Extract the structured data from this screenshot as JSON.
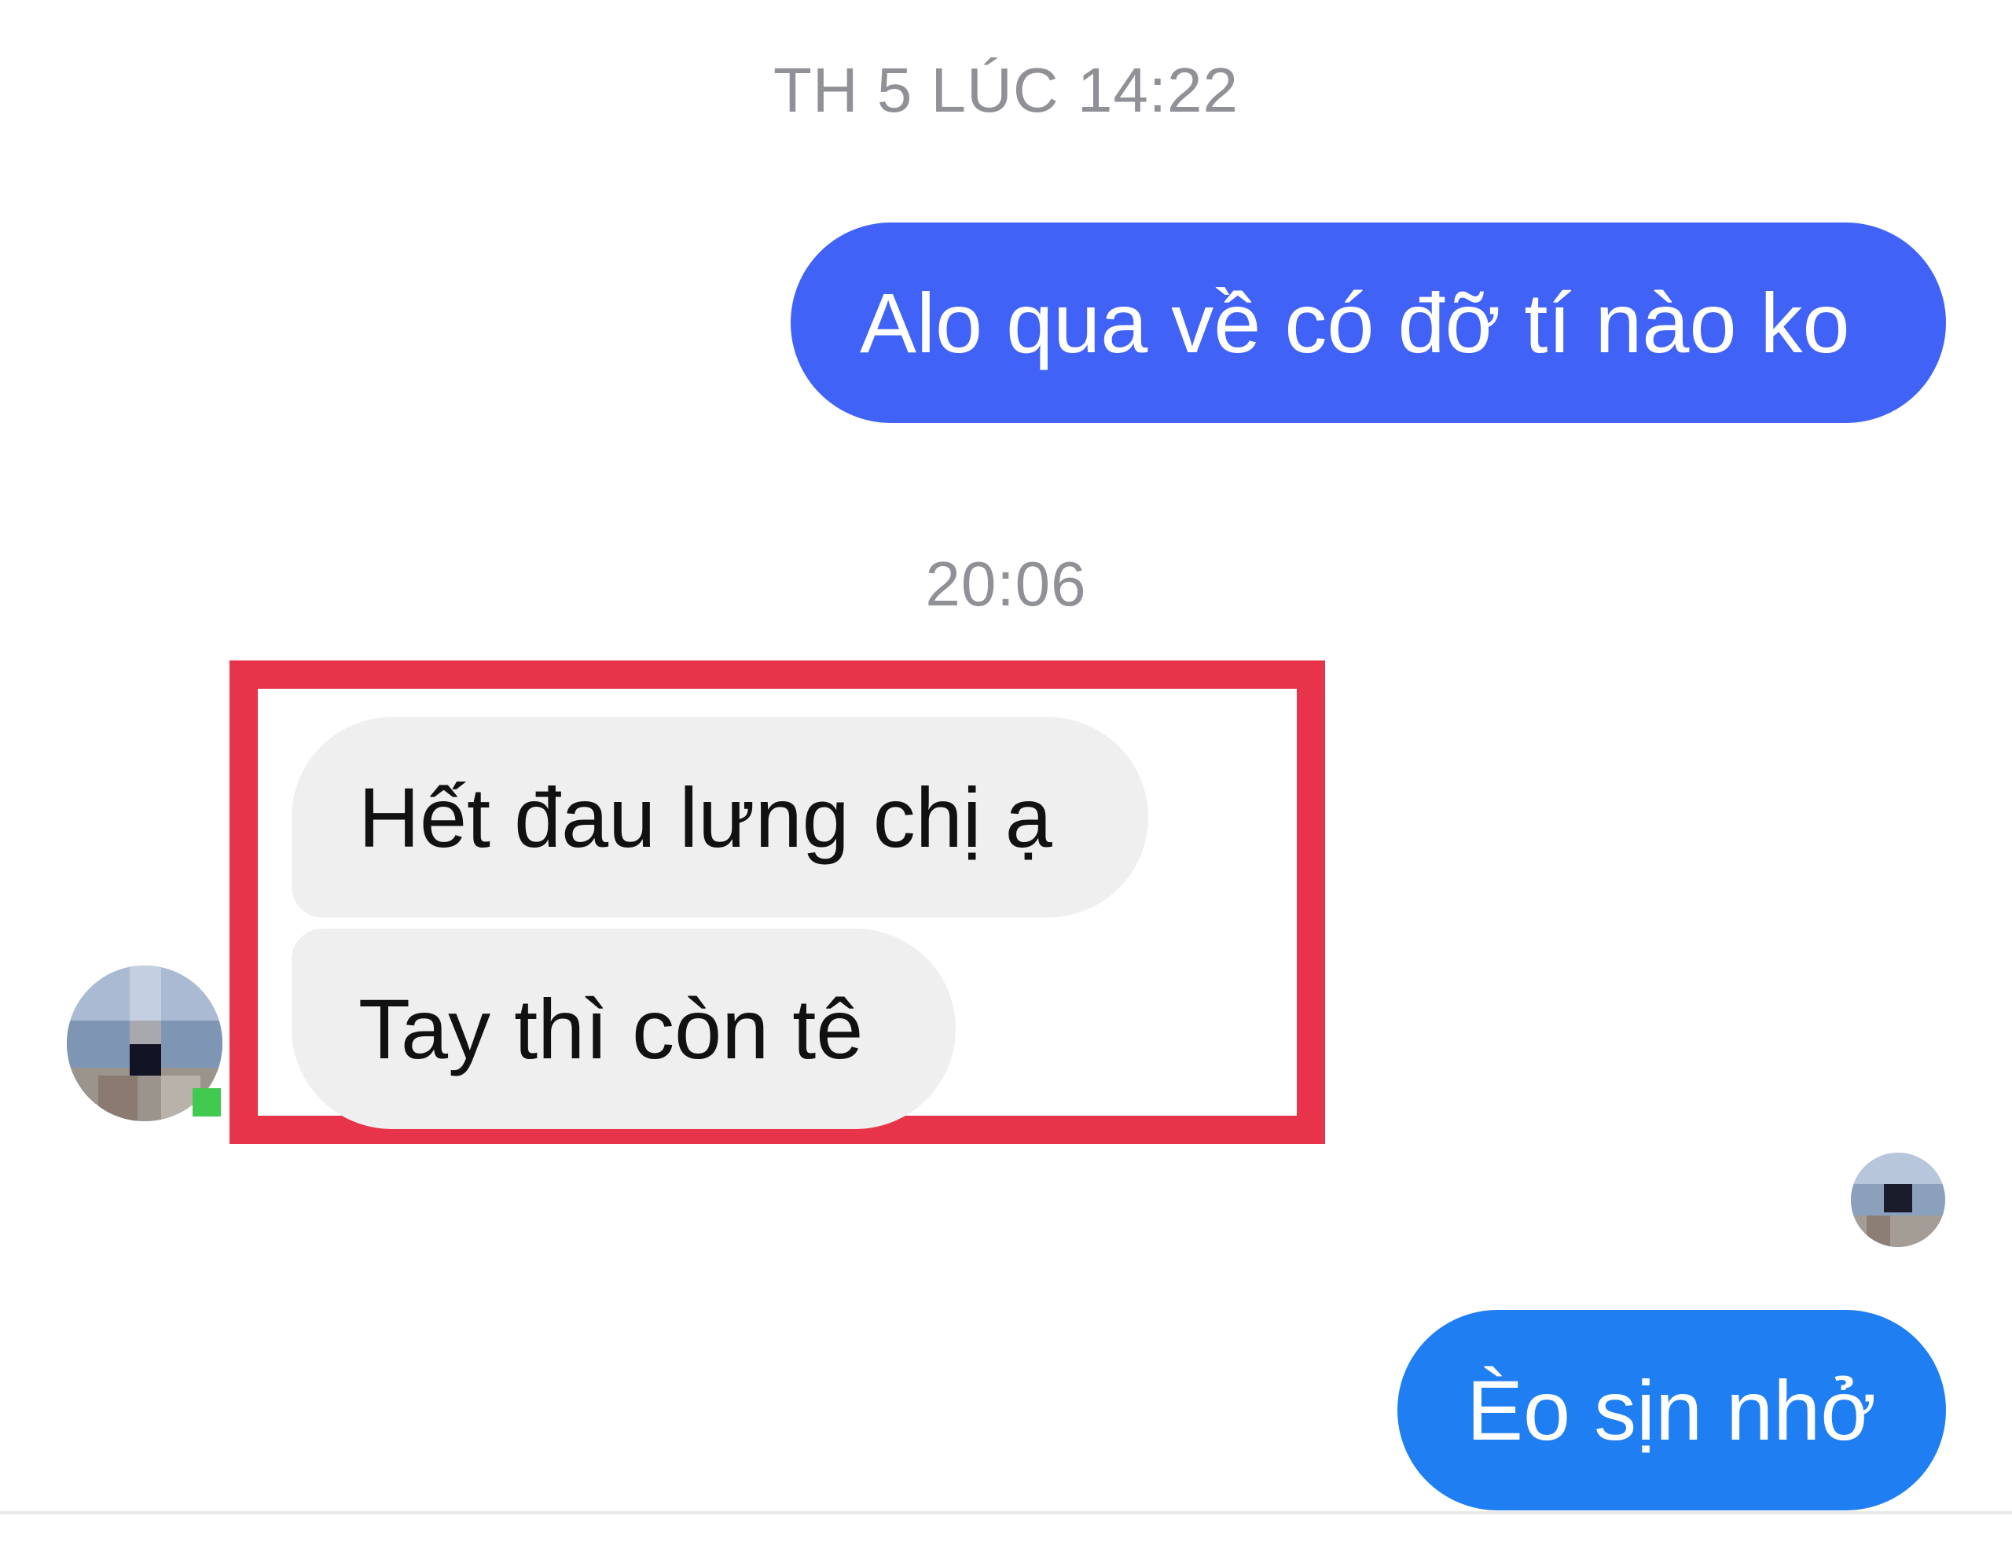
{
  "conversation": {
    "timestamp_1": "TH 5 LÚC 14:22",
    "timestamp_2": "20:06",
    "messages": [
      {
        "sender": "me",
        "text": "Alo qua về có đỡ tí nào ko"
      },
      {
        "sender": "other",
        "text": "Hết đau lưng chị ạ"
      },
      {
        "sender": "other",
        "text": "Tay thì còn tê"
      },
      {
        "sender": "me",
        "text": "Èo sịn nhở"
      }
    ]
  },
  "colors": {
    "sent_bubble_1": "#4062f7",
    "sent_bubble_2": "#1f7ef2",
    "received_bubble": "#efefef",
    "highlight_border": "#e8344a",
    "timestamp_text": "#8f9196",
    "online_indicator": "#42c94f"
  },
  "icons": {
    "contact_avatar": "blurred-avatar",
    "seen_indicator": "blurred-seen-avatar"
  }
}
